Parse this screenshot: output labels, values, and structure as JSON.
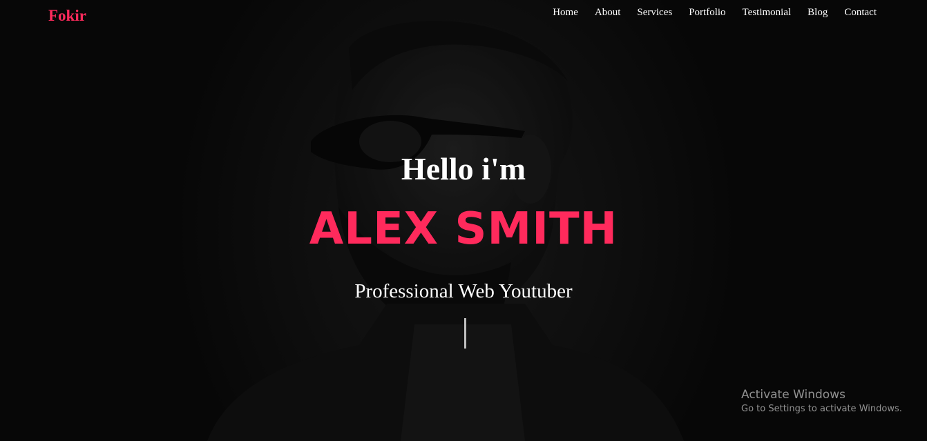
{
  "brand": {
    "logo": "Fokir",
    "accent_color": "#ff2a5c"
  },
  "nav": {
    "items": [
      {
        "label": "Home"
      },
      {
        "label": "About"
      },
      {
        "label": "Services"
      },
      {
        "label": "Portfolio"
      },
      {
        "label": "Testimonial"
      },
      {
        "label": "Blog"
      },
      {
        "label": "Contact"
      }
    ]
  },
  "hero": {
    "greeting": "Hello i'm",
    "name": "ALEX SMITH",
    "profession": "Professional Web Youtuber",
    "background_image": "portrait-bearded-man-sunglasses"
  },
  "watermark": {
    "title": "Activate Windows",
    "subtitle": "Go to Settings to activate Windows."
  }
}
